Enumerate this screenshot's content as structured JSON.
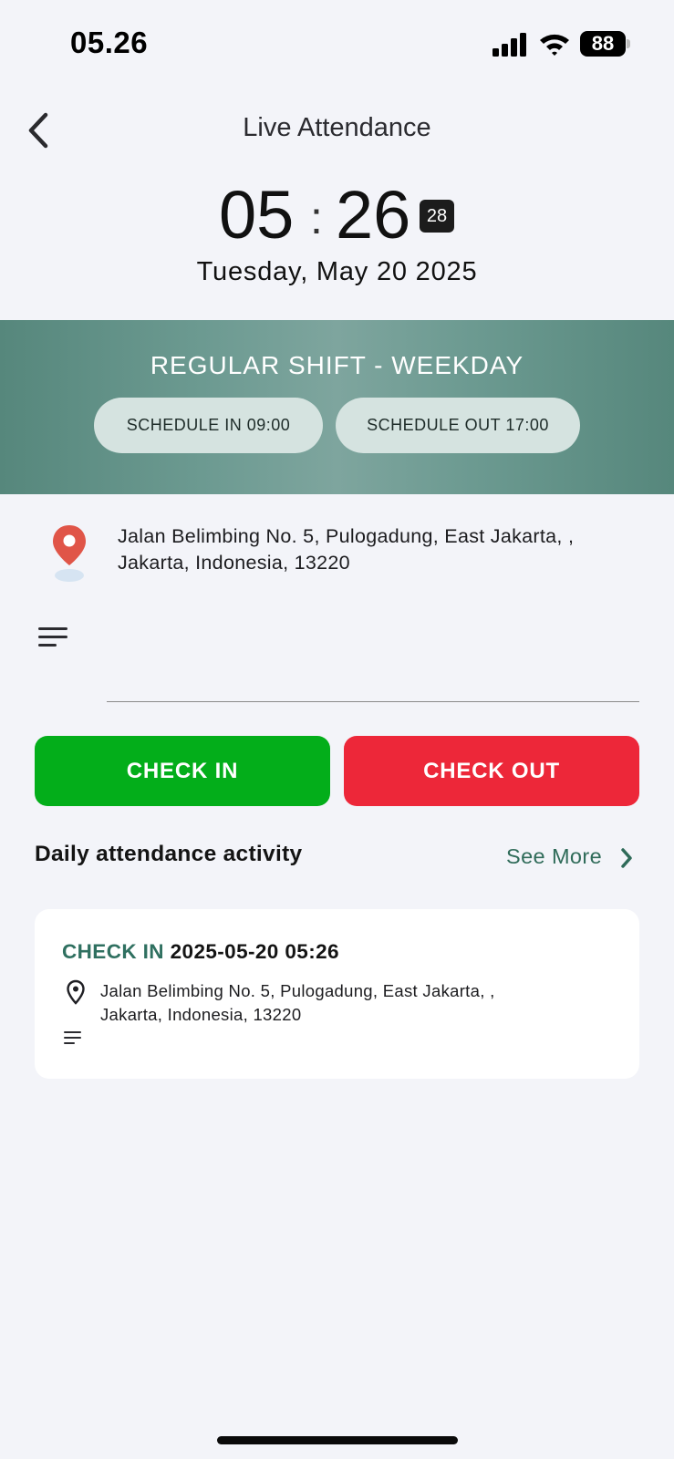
{
  "status_bar": {
    "time": "05.26",
    "battery": "88"
  },
  "header": {
    "title": "Live Attendance"
  },
  "clock": {
    "hours": "05",
    "separator": ":",
    "minutes": "26",
    "seconds": "28",
    "date": "Tuesday, May 20 2025"
  },
  "shift": {
    "name": "REGULAR SHIFT - WEEKDAY",
    "schedule_in": "SCHEDULE IN 09:00",
    "schedule_out": "SCHEDULE OUT 17:00"
  },
  "location": {
    "address": "Jalan Belimbing No. 5, Pulogadung, East Jakarta, , Jakarta, Indonesia, 13220"
  },
  "notes": {
    "value": "",
    "placeholder": ""
  },
  "actions": {
    "check_in": "CHECK IN",
    "check_out": "CHECK OUT"
  },
  "activity": {
    "title": "Daily attendance activity",
    "see_more": "See More",
    "items": [
      {
        "type": "CHECK IN",
        "datetime": "2025-05-20 05:26",
        "address_line1": "Jalan Belimbing No. 5, Pulogadung, East Jakarta, ,",
        "address_line2": "Jakarta, Indonesia, 13220"
      }
    ]
  },
  "colors": {
    "background": "#f3f4f9",
    "banner": "#5f8f84",
    "check_in": "#03ae1a",
    "check_out": "#ed2739",
    "accent": "#2f6b59",
    "pin": "#e05548"
  },
  "icons": [
    "back-chevron-icon",
    "signal-icon",
    "wifi-icon",
    "battery-icon",
    "location-pin-icon",
    "notes-icon",
    "chevron-right-icon"
  ]
}
